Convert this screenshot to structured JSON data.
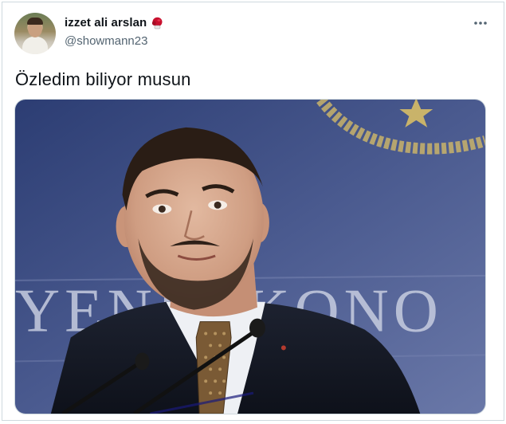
{
  "tweet": {
    "author": {
      "display_name": "izzet ali arslan",
      "name_emoji_icon": "boxing-glove-icon",
      "handle": "@showmann23"
    },
    "more_icon": "more-horizontal-icon",
    "text": "Özledim biliyor musun",
    "media": {
      "background_caption": "YENİ EKONO"
    }
  },
  "colors": {
    "text_primary": "#0f1419",
    "text_secondary": "#536471",
    "border": "#cfd9de",
    "glove": "#c8102e"
  }
}
